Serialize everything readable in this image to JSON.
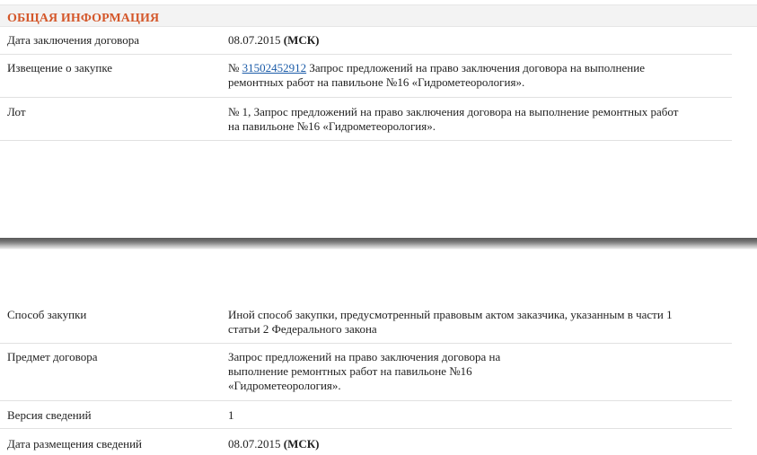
{
  "section": {
    "title": "ОБЩАЯ ИНФОРМАЦИЯ"
  },
  "rows_top": {
    "contract_date": {
      "label": "Дата заключения договора",
      "date": "08.07.2015",
      "tz": "(МСК)"
    },
    "notice": {
      "label": "Извещение о закупке",
      "prefix": "№",
      "number": "31502452912",
      "text_line1": "Запрос предложений на право заключения договора на выполнение",
      "text_line2": "ремонтных работ на павильоне №16 «Гидрометеорология»."
    },
    "lot": {
      "label": "Лот",
      "line1": "№ 1, Запрос предложений на право заключения договора на выполнение ремонтных работ",
      "line2": "на павильоне №16 «Гидрометеорология»."
    }
  },
  "rows_bottom": {
    "method": {
      "label": "Способ закупки",
      "line1": "Иной способ закупки, предусмотренный правовым актом заказчика, указанным в части 1",
      "line2": "статьи 2 Федерального закона"
    },
    "subject": {
      "label": "Предмет договора",
      "line1": "Запрос предложений на право заключения договора на",
      "line2": "выполнение ремонтных работ на павильоне №16",
      "line3": "«Гидрометеорология»."
    },
    "version": {
      "label": "Версия сведений",
      "value": "1"
    },
    "published": {
      "label": "Дата размещения сведений",
      "date": "08.07.2015",
      "tz": "(МСК)"
    }
  }
}
